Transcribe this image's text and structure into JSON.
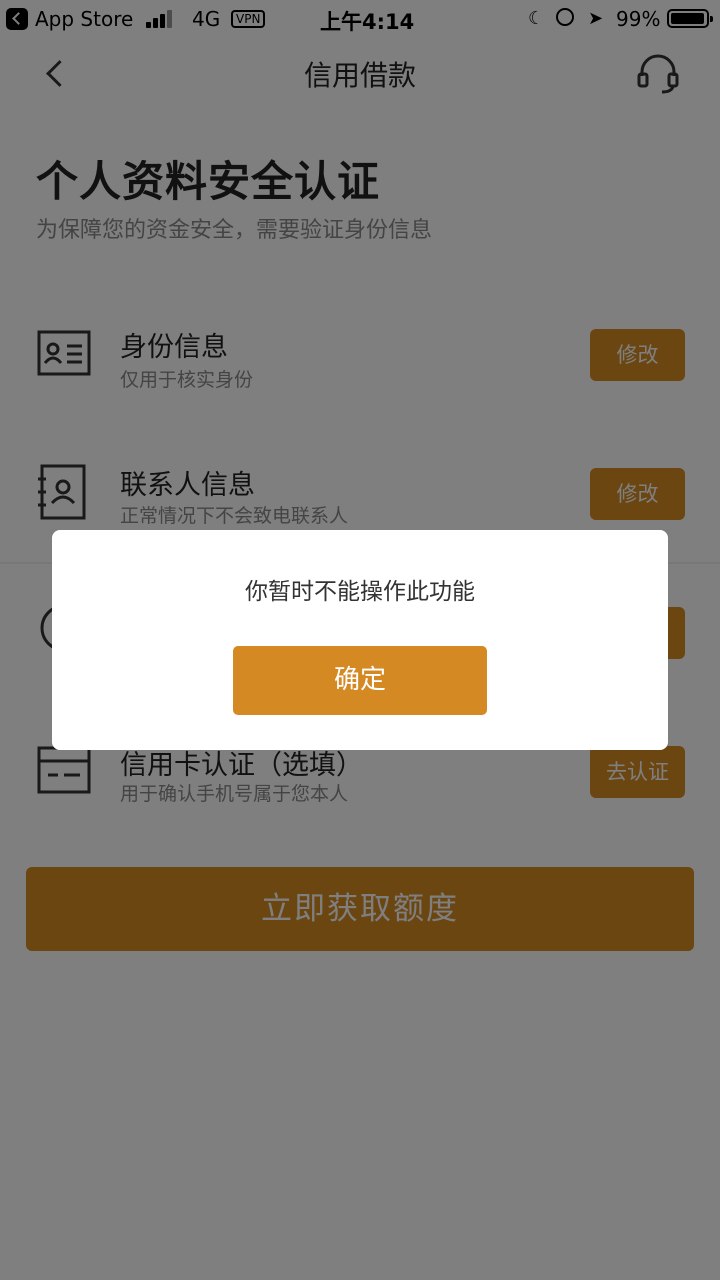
{
  "status_bar": {
    "back_app": "App Store",
    "network": "4G",
    "vpn": "VPN",
    "time": "上午4:14",
    "battery": "99%"
  },
  "nav": {
    "title": "信用借款",
    "back_icon": "chevron-left-icon",
    "support_icon": "headset-icon"
  },
  "header": {
    "title": "个人资料安全认证",
    "subtitle": "为保障您的资金安全，需要验证身份信息"
  },
  "items": [
    {
      "title": "身份信息",
      "desc": "仅用于核实身份",
      "button": "修改",
      "icon": "id-card-icon"
    },
    {
      "title": "联系人信息",
      "desc": "正常情况下不会致电联系人",
      "button": "修改",
      "icon": "contact-book-icon"
    },
    {
      "title": "",
      "desc": "",
      "button": "",
      "icon": "phone-icon"
    },
    {
      "title": "信用卡认证（选填）",
      "desc": "用于确认手机号属于您本人",
      "button": "去认证",
      "icon": "credit-card-icon"
    }
  ],
  "cta": {
    "label": "立即获取额度"
  },
  "dialog": {
    "message": "你暂时不能操作此功能",
    "confirm": "确定"
  },
  "colors": {
    "accent": "#d78c22",
    "overlay": "rgba(0,0,0,0.5)"
  }
}
